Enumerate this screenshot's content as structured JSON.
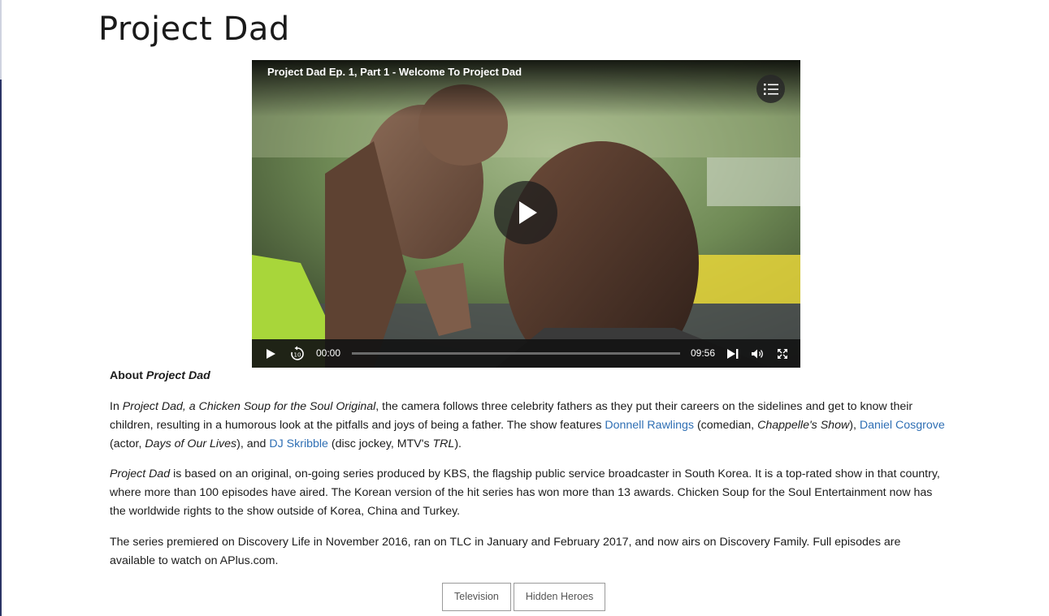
{
  "page": {
    "title": "Project Dad"
  },
  "video": {
    "title": "Project Dad Ep. 1, Part 1 - Welcome To Project Dad",
    "current_time": "00:00",
    "duration": "09:56",
    "progress": 0
  },
  "about": {
    "heading_prefix": "About ",
    "heading_show": "Project Dad",
    "p1": {
      "t1": "In ",
      "show_italic": "Project Dad, a Chicken Soup for the Soul Original",
      "t2": ", the camera follows three celebrity fathers as they put their careers on the sidelines and get to know their children, resulting in a humorous look at the pitfalls and joys of being a father. The show features ",
      "link1": "Donnell Rawlings",
      "t3": " (comedian, ",
      "italic1": "Chappelle's Show",
      "t4": "), ",
      "link2": "Daniel Cosgrove",
      "t5": " (actor, ",
      "italic2": "Days of Our Lives",
      "t6": "), and ",
      "link3": "DJ Skribble",
      "t7": " (disc jockey, MTV's ",
      "italic3": "TRL",
      "t8": ")."
    },
    "p2": {
      "show_italic": "Project Dad",
      "text": " is based on an original, on-going series produced by KBS, the flagship public service broadcaster in South Korea. It is a top-rated show in that country, where more than 100 episodes have aired. The Korean version of the hit series has won more than 13 awards. Chicken Soup for the Soul Entertainment now has the worldwide rights to the show outside of Korea, China and Turkey."
    },
    "p3": "The series premiered on Discovery Life in November 2016, ran on TLC in January and February 2017, and now airs on Discovery Family. Full episodes are available to watch on APlus.com."
  },
  "tags": [
    "Television",
    "Hidden Heroes"
  ],
  "colors": {
    "link": "#2f6fb4",
    "accent_bar": "#2b3566"
  }
}
